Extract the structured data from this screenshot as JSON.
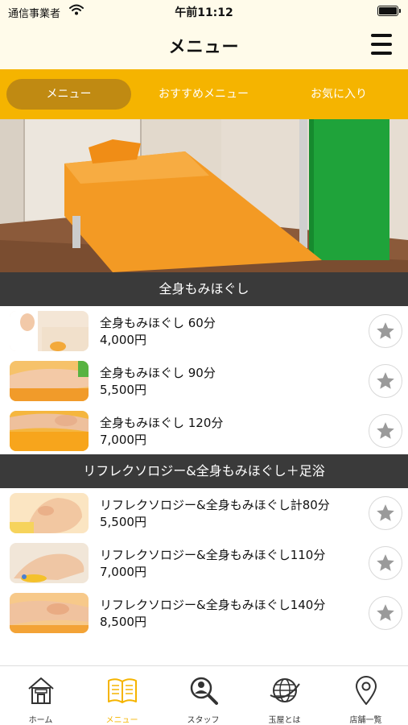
{
  "status_bar": {
    "carrier": "通信事業者",
    "time": "午前11:12"
  },
  "nav": {
    "title": "メニュー"
  },
  "tabs": [
    {
      "label": "メニュー",
      "active": true
    },
    {
      "label": "おすすめメニュー",
      "active": false
    },
    {
      "label": "お気に入り",
      "active": false
    }
  ],
  "sections": [
    {
      "title": "全身もみほぐし",
      "items": [
        {
          "name": "全身もみほぐし 60分",
          "price": "4,000円"
        },
        {
          "name": "全身もみほぐし 90分",
          "price": "5,500円"
        },
        {
          "name": "全身もみほぐし 120分",
          "price": "7,000円"
        }
      ]
    },
    {
      "title": "リフレクソロジー&全身もみほぐし＋足浴",
      "items": [
        {
          "name": "リフレクソロジー&全身もみほぐし計80分",
          "price": "5,500円"
        },
        {
          "name": "リフレクソロジー&全身もみほぐし110分",
          "price": "7,000円"
        },
        {
          "name": "リフレクソロジー&全身もみほぐし140分",
          "price": "8,500円"
        }
      ]
    }
  ],
  "bottom_nav": [
    {
      "label": "ホーム",
      "icon": "home-icon",
      "active": false
    },
    {
      "label": "メニュー",
      "icon": "book-icon",
      "active": true
    },
    {
      "label": "スタッフ",
      "icon": "staff-search-icon",
      "active": false
    },
    {
      "label": "玉屋とは",
      "icon": "globe-icon",
      "active": false
    },
    {
      "label": "店舗一覧",
      "icon": "location-pin-icon",
      "active": false
    }
  ],
  "colors": {
    "accent": "#f5b400",
    "tab_active": "#c08a12",
    "header_bg": "#fffbea",
    "section_bg": "#3a3a3a",
    "star": "#9a9a9a"
  }
}
